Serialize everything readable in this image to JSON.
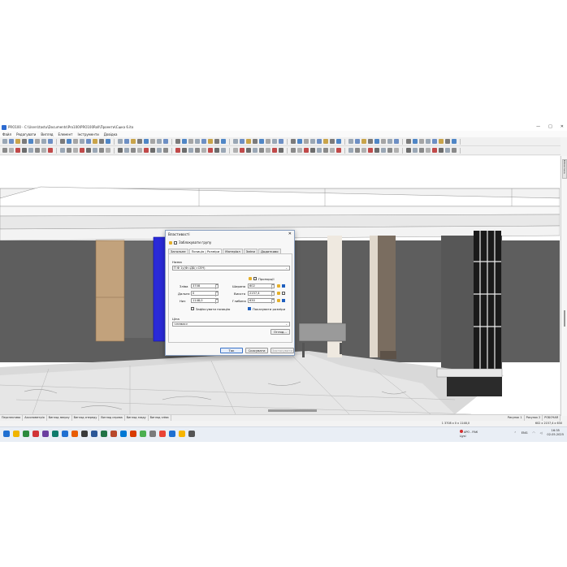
{
  "window": {
    "title": "PRO100 - C:\\Users\\tastu\\Documents\\Pro100\\PRO100Roll\\Проекти\\Сшка 6.ito",
    "controls": [
      "—",
      "□",
      "✕"
    ]
  },
  "menu": [
    "Файл",
    "Редагувати",
    "Вигляд",
    "Елемент",
    "Інструменти",
    "Довідка"
  ],
  "right_panel": {
    "tab_label": "Бібліотека"
  },
  "bottom_tabs": [
    "Перспектива",
    "Аксонометрія",
    "Вигляд зверху",
    "Вигляд спереду",
    "Вигляд справа",
    "Вигляд ззаду",
    "Вигляд зліва"
  ],
  "bottom_tabs_right": [
    "Рисунок 1",
    "Рисунок 2",
    "РОБОЧАЯ"
  ],
  "status": {
    "position": "1 3708 x 0 x 1148,0",
    "size": "602 x 2157,4 x 630"
  },
  "dialog": {
    "title": "Властивості",
    "close": "✕",
    "lock_group_label": "Заблокувати групу",
    "tabs": [
      "Загальне",
      "Позиція | Розміри",
      "Матеріал",
      "Зміни",
      "Додатково"
    ],
    "active_tab": "Позиція | Розміри",
    "name_label": "Назва",
    "name_value": "П Ф 1у(Ф=ДБ(=СВЧ)",
    "proportions_label": "Пропорції",
    "left_label": "Зліва",
    "left_value": "3708",
    "depth_pos_label": "Дальнє",
    "depth_pos_value": "0",
    "below_label": "Низ",
    "below_value": "1148,0",
    "width_label": "Ширина",
    "width_value": "602",
    "height_label": "Висота",
    "height_value": "2157,4",
    "depth_label": "Глибина",
    "depth_value": "630",
    "fix_position_label": "Зафіксувати позицію",
    "show_sizes_label": "Показувати розміри",
    "price_label": "Ціна",
    "price_value": "<немає>",
    "review_button": "Огляд...",
    "ok_button": "Так",
    "cancel_button": "Скасувати",
    "apply_button": "Застосувати"
  },
  "taskbar": {
    "weather_title": "АРО - РАК",
    "weather_sub": "Цукі",
    "lang": "ENG",
    "time": "16:35",
    "date": "02.05.2025"
  },
  "colors": {
    "accent": "#1f5fbf",
    "wall": "#5c5c5c",
    "selection_blue": "#2a2ad8",
    "cabinet_wood": "#c2a27c"
  }
}
